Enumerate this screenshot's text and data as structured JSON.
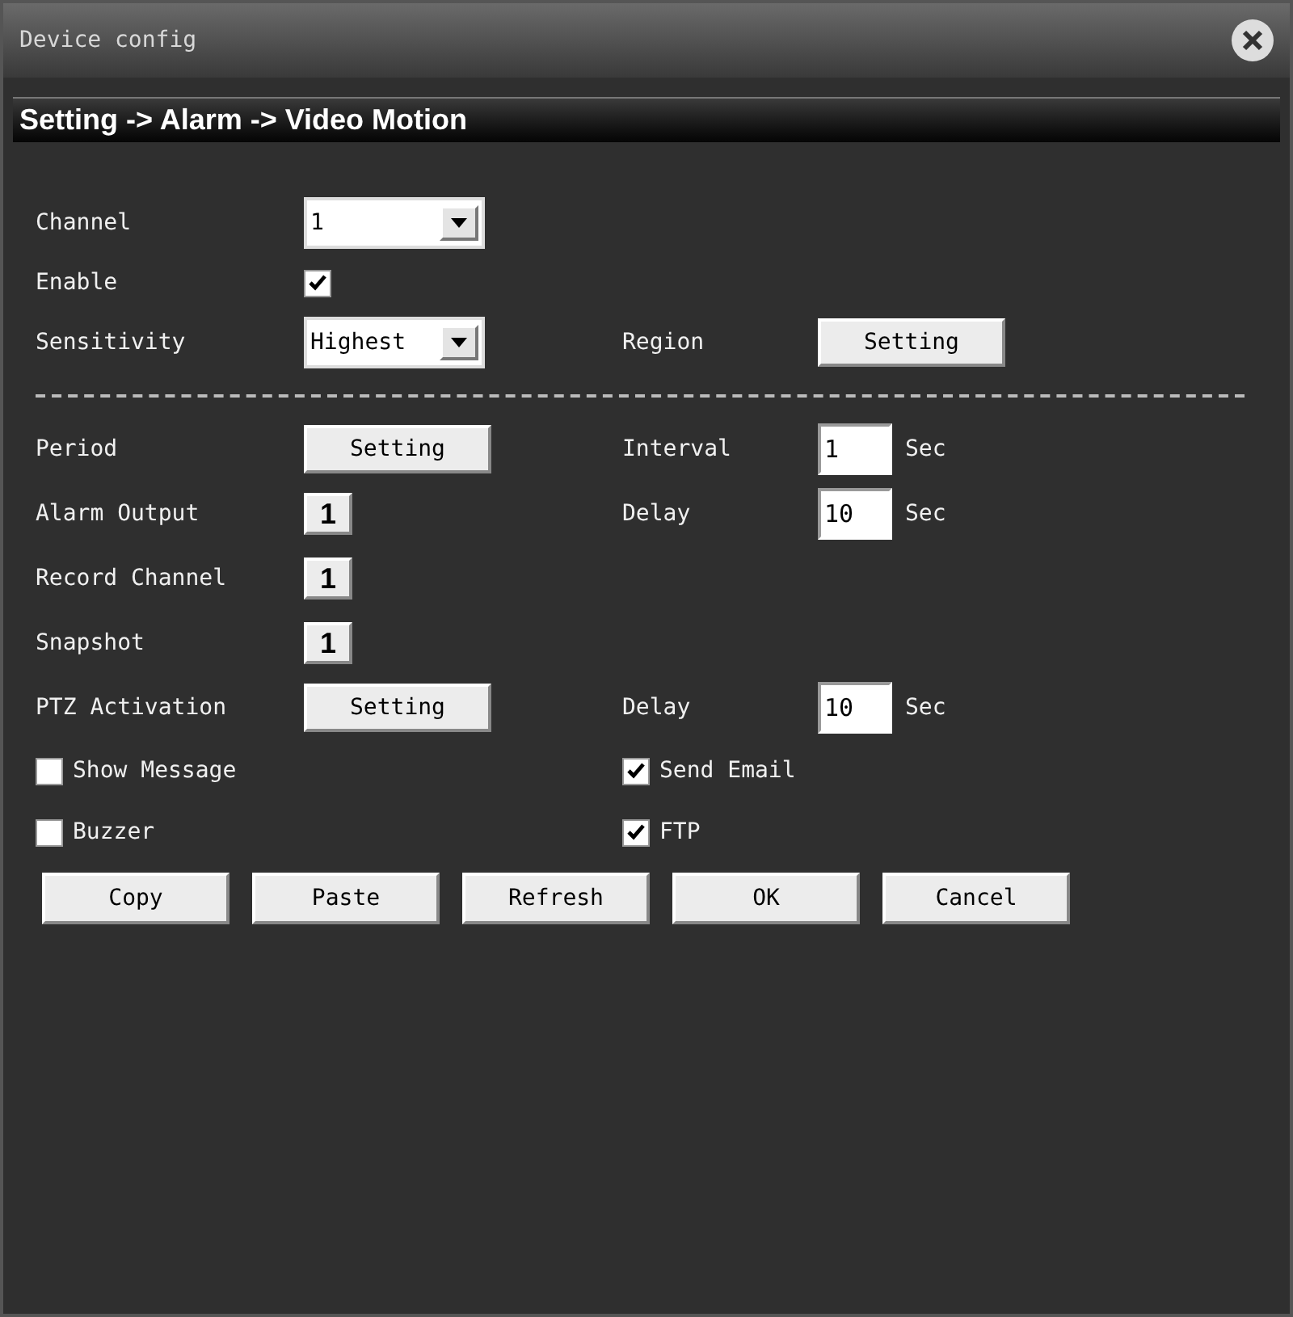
{
  "window": {
    "title": "Device config"
  },
  "breadcrumb": "Setting -> Alarm -> Video Motion",
  "rows": [
    {
      "left": {
        "kind": "select",
        "label": "Channel",
        "value": "1"
      }
    },
    {
      "left": {
        "kind": "checkbox",
        "label": "Enable",
        "checked": true
      }
    },
    {
      "left": {
        "kind": "select",
        "label": "Sensitivity",
        "value": "Highest"
      },
      "right": {
        "kind": "button",
        "label": "Region",
        "button": "Setting"
      }
    },
    {
      "left": {
        "kind": "divider"
      }
    },
    {
      "left": {
        "kind": "button",
        "label": "Period",
        "button": "Setting"
      },
      "right": {
        "kind": "input",
        "label": "Interval",
        "value": "1",
        "unit": "Sec"
      }
    },
    {
      "left": {
        "kind": "picker",
        "label": "Alarm Output",
        "value": "1"
      },
      "right": {
        "kind": "input",
        "label": "Delay",
        "value": "10",
        "unit": "Sec"
      }
    },
    {
      "left": {
        "kind": "picker",
        "label": "Record Channel",
        "value": "1"
      }
    },
    {
      "left": {
        "kind": "picker",
        "label": "Snapshot",
        "value": "1"
      }
    },
    {
      "left": {
        "kind": "button",
        "label": "PTZ Activation",
        "button": "Setting"
      },
      "right": {
        "kind": "input",
        "label": "Delay",
        "value": "10",
        "unit": "Sec"
      }
    },
    {
      "left": {
        "kind": "check",
        "label": "Show Message",
        "checked": false
      },
      "right": {
        "kind": "check",
        "label": "Send Email",
        "checked": true
      }
    },
    {
      "left": {
        "kind": "check",
        "label": "Buzzer",
        "checked": false
      },
      "right": {
        "kind": "check",
        "label": "FTP",
        "checked": true
      }
    }
  ],
  "buttons": [
    "Copy",
    "Paste",
    "Refresh",
    "OK",
    "Cancel"
  ]
}
